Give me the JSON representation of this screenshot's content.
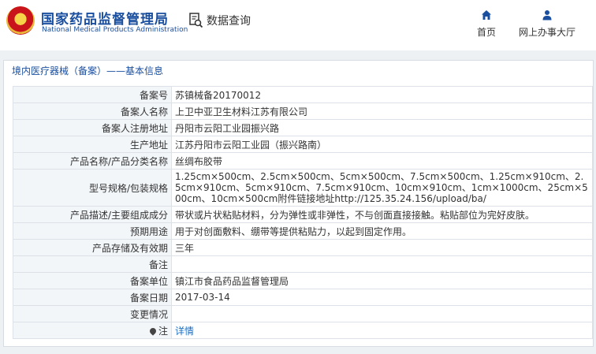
{
  "header": {
    "org_name_cn": "国家药品监督管理局",
    "org_name_en": "National Medical Products Administration",
    "search_label": "数据查询",
    "nav": [
      {
        "label": "首页",
        "icon": "home-icon"
      },
      {
        "label": "网上办事大厅",
        "icon": "user-icon"
      }
    ]
  },
  "breadcrumb": "境内医疗器械（备案）——基本信息",
  "record": {
    "rows": [
      {
        "label": "备案号",
        "value": "苏镇械备20170012"
      },
      {
        "label": "备案人名称",
        "value": "上卫中亚卫生材料江苏有限公司"
      },
      {
        "label": "备案人注册地址",
        "value": "丹阳市云阳工业园振兴路"
      },
      {
        "label": "生产地址",
        "value": "江苏丹阳市云阳工业园（振兴路南）"
      },
      {
        "label": "产品名称/产品分类名称",
        "value": "丝绸布胶带"
      },
      {
        "label": "型号规格/包装规格",
        "value": "1.25cm×500cm、2.5cm×500cm、5cm×500cm、7.5cm×500cm、1.25cm×910cm、2.5cm×910cm、5cm×910cm、7.5cm×910cm、10cm×910cm、1cm×1000cm、25cm×500cm、10cm×500cm附件链接地址http://125.35.24.156/upload/ba/"
      },
      {
        "label": "产品描述/主要组成成分",
        "value": "带状或片状粘贴材料，分为弹性或非弹性，不与创面直接接触。粘贴部位为完好皮肤。"
      },
      {
        "label": "预期用途",
        "value": "用于对创面敷料、绷带等提供粘贴力，以起到固定作用。"
      },
      {
        "label": "产品存储及有效期",
        "value": "三年"
      },
      {
        "label": "备注",
        "value": ""
      },
      {
        "label": "备案单位",
        "value": "镇江市食品药品监督管理局"
      },
      {
        "label": "备案日期",
        "value": "2017-03-14"
      },
      {
        "label": "变更情况",
        "value": ""
      }
    ],
    "note_label": "注",
    "note_link": "详情"
  }
}
